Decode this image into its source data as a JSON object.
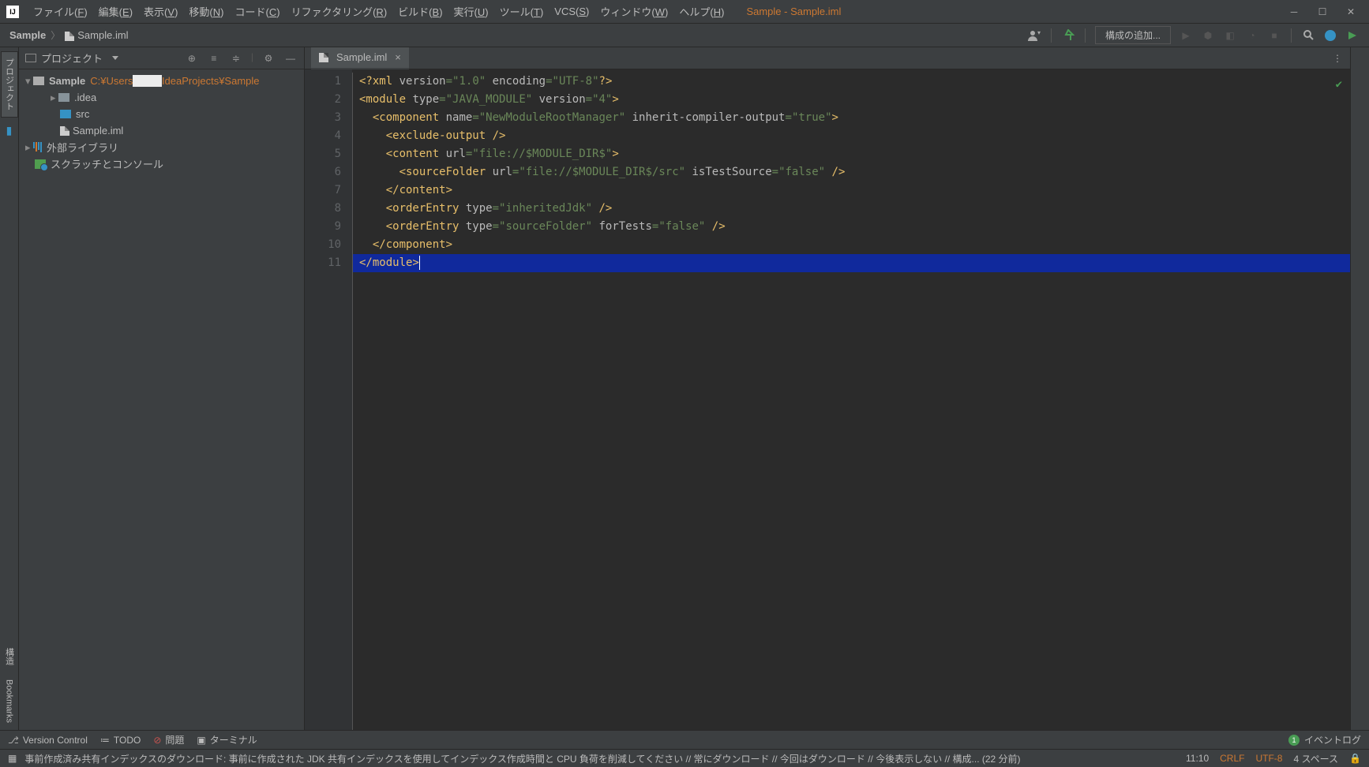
{
  "window": {
    "title": "Sample - Sample.iml"
  },
  "menu": {
    "items": [
      {
        "label": "ファイル",
        "hotkey": "F"
      },
      {
        "label": "編集",
        "hotkey": "E"
      },
      {
        "label": "表示",
        "hotkey": "V"
      },
      {
        "label": "移動",
        "hotkey": "N"
      },
      {
        "label": "コード",
        "hotkey": "C"
      },
      {
        "label": "リファクタリング",
        "hotkey": "R"
      },
      {
        "label": "ビルド",
        "hotkey": "B"
      },
      {
        "label": "実行",
        "hotkey": "U"
      },
      {
        "label": "ツール",
        "hotkey": "T"
      },
      {
        "label": "VCS",
        "hotkey": "S"
      },
      {
        "label": "ウィンドウ",
        "hotkey": "W"
      },
      {
        "label": "ヘルプ",
        "hotkey": "H"
      }
    ]
  },
  "breadcrumbs": {
    "project": "Sample",
    "file": "Sample.iml"
  },
  "toolbar": {
    "config": "構成の追加..."
  },
  "project_panel": {
    "title": "プロジェクト",
    "tree": {
      "root_name": "Sample",
      "root_path_prefix": "C:¥Users",
      "root_path_suffix": "IdeaProjects¥Sample",
      "idea": ".idea",
      "src": "src",
      "iml": "Sample.iml",
      "external_libs": "外部ライブラリ",
      "scratches": "スクラッチとコンソール"
    }
  },
  "side_tabs": {
    "project": "プロジェクト",
    "structure": "構造",
    "bookmarks": "Bookmarks"
  },
  "editor": {
    "tab": "Sample.iml",
    "gutter": [
      "1",
      "2",
      "3",
      "4",
      "5",
      "6",
      "7",
      "8",
      "9",
      "10",
      "11"
    ],
    "code": {
      "l1": {
        "pre": "<?",
        "xml": "xml",
        "attr1": "version",
        "eq1": "=",
        "val1": "\"1.0\"",
        "attr2": "encoding",
        "eq2": "=",
        "val2": "\"UTF-8\"",
        "end": "?>"
      },
      "l2": {
        "open": "<module",
        "a1": "type",
        "v1": "\"JAVA_MODULE\"",
        "a2": "version",
        "v2": "\"4\"",
        "close": ">"
      },
      "l3": {
        "open": "<component",
        "a1": "name",
        "v1": "\"NewModuleRootManager\"",
        "a2": "inherit-compiler-output",
        "v2": "\"true\"",
        "close": ">"
      },
      "l4": {
        "tag": "<exclude-output />"
      },
      "l5": {
        "open": "<content",
        "a1": "url",
        "v1": "\"file://$MODULE_DIR$\"",
        "close": ">"
      },
      "l6": {
        "open": "<sourceFolder",
        "a1": "url",
        "v1": "\"file://$MODULE_DIR$/src\"",
        "a2": "isTestSource",
        "v2": "\"false\"",
        "close": " />"
      },
      "l7": {
        "tag": "</content>"
      },
      "l8": {
        "open": "<orderEntry",
        "a1": "type",
        "v1": "\"inheritedJdk\"",
        "close": " />"
      },
      "l9": {
        "open": "<orderEntry",
        "a1": "type",
        "v1": "\"sourceFolder\"",
        "a2": "forTests",
        "v2": "\"false\"",
        "close": " />"
      },
      "l10": {
        "tag": "</component>"
      },
      "l11": {
        "tag": "</module>"
      }
    }
  },
  "tool_windows": {
    "vcs": "Version Control",
    "todo": "TODO",
    "problems": "問題",
    "terminal": "ターミナル",
    "event_log": "イベントログ",
    "event_count": "1"
  },
  "statusbar": {
    "message": "事前作成済み共有インデックスのダウンロード: 事前に作成された JDK 共有インデックスを使用してインデックス作成時間と CPU 負荷を削減してください // 常にダウンロード // 今回はダウンロード // 今後表示しない // 構成... (22 分前)",
    "position": "11:10",
    "line_sep": "CRLF",
    "encoding": "UTF-8",
    "indent": "4 スペース"
  }
}
